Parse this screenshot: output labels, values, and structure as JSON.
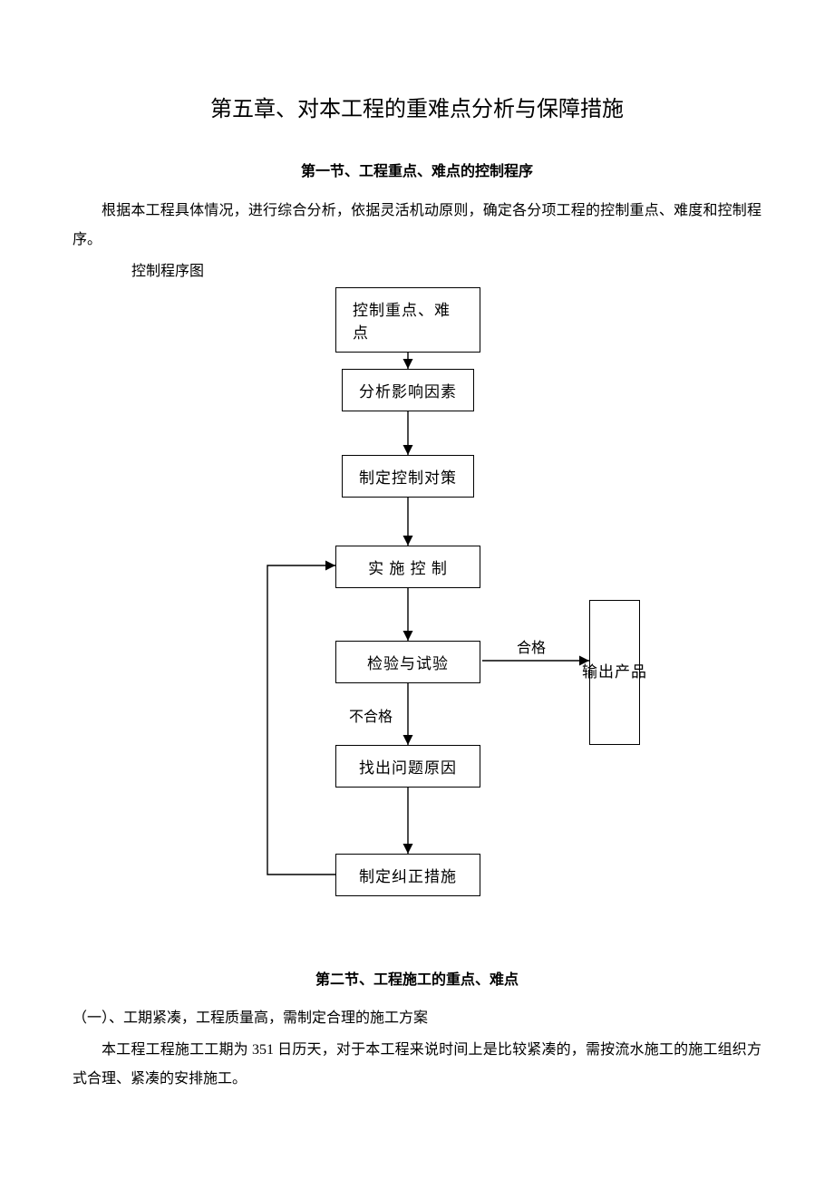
{
  "chapter": {
    "title": "第五章、对本工程的重难点分析与保障措施"
  },
  "section1": {
    "title": "第一节、工程重点、难点的控制程序",
    "p1": "根据本工程具体情况，进行综合分析，依据灵活机动原则，确定各分项工程的控制重点、难度和控制程序。",
    "diagram_label": "控制程序图"
  },
  "chart_data": {
    "type": "flowchart",
    "nodes": [
      {
        "id": "n1",
        "label": "控制重点、难点"
      },
      {
        "id": "n2",
        "label": "分析影响因素"
      },
      {
        "id": "n3",
        "label": "制定控制对策"
      },
      {
        "id": "n4",
        "label": "实 施 控 制"
      },
      {
        "id": "n5",
        "label": "检验与试验"
      },
      {
        "id": "n6",
        "label": "找出问题原因"
      },
      {
        "id": "n7",
        "label": "制定纠正措施"
      },
      {
        "id": "out",
        "label": "输出产品"
      }
    ],
    "edges": [
      {
        "from": "n1",
        "to": "n2",
        "label": ""
      },
      {
        "from": "n2",
        "to": "n3",
        "label": ""
      },
      {
        "from": "n3",
        "to": "n4",
        "label": ""
      },
      {
        "from": "n4",
        "to": "n5",
        "label": ""
      },
      {
        "from": "n5",
        "to": "n6",
        "label": "不合格"
      },
      {
        "from": "n5",
        "to": "out",
        "label": "合格"
      },
      {
        "from": "n6",
        "to": "n7",
        "label": ""
      },
      {
        "from": "n7",
        "to": "n4",
        "label": ""
      }
    ],
    "out_vertical_chars": [
      "输",
      "出",
      "产",
      "品"
    ]
  },
  "section2": {
    "title": "第二节、工程施工的重点、难点",
    "sub1": "（一）、工期紧凑，工程质量高，需制定合理的施工方案",
    "p1": "本工程工程施工工期为 351 日历天，对于本工程来说时间上是比较紧凑的，需按流水施工的施工组织方式合理、紧凑的安排施工。"
  }
}
